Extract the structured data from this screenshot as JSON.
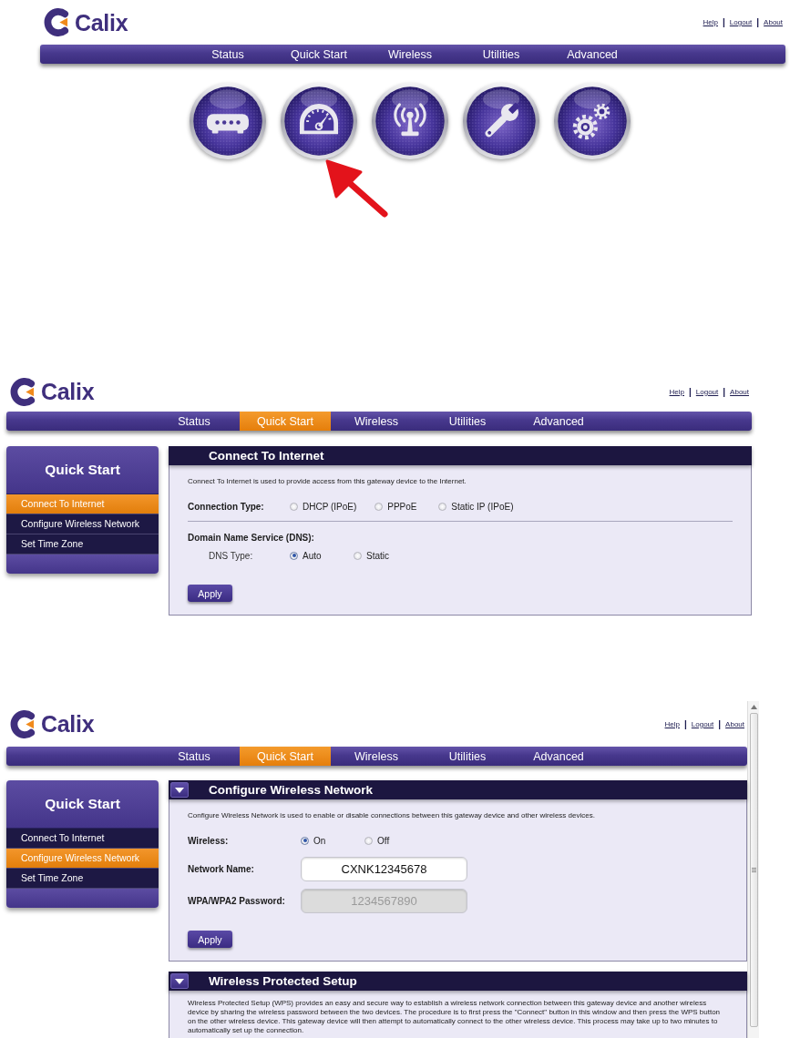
{
  "frames": [
    {
      "header": {
        "logo": "Calix",
        "links": [
          {
            "label": "Help",
            "separator": "|"
          },
          {
            "label": "Logout",
            "separator": "|"
          },
          {
            "label": "About"
          }
        ]
      },
      "nav": {
        "tabs": [
          {
            "label": "Status",
            "selected": false
          },
          {
            "label": "Quick Start",
            "selected": false
          },
          {
            "label": "Wireless",
            "selected": false
          },
          {
            "label": "Utilities",
            "selected": false
          },
          {
            "label": "Advanced",
            "selected": false
          }
        ]
      },
      "icon_buttons": [
        {
          "kind": "router",
          "annotated": false
        },
        {
          "kind": "gauge",
          "annotated": true
        },
        {
          "kind": "antenna",
          "annotated": false
        },
        {
          "kind": "wrench",
          "annotated": false
        },
        {
          "kind": "gears",
          "annotated": false
        }
      ]
    },
    {
      "header": {
        "logo": "Calix",
        "links": [
          {
            "label": "Help",
            "separator": "|"
          },
          {
            "label": "Logout",
            "separator": "|"
          },
          {
            "label": "About"
          }
        ]
      },
      "nav": {
        "tabs": [
          {
            "label": "Status",
            "selected": false
          },
          {
            "label": "Quick Start",
            "selected": true
          },
          {
            "label": "Wireless",
            "selected": false
          },
          {
            "label": "Utilities",
            "selected": false
          },
          {
            "label": "Advanced",
            "selected": false
          }
        ]
      },
      "sidebar": {
        "title": "Quick Start",
        "items": [
          {
            "label": "Connect To Internet",
            "selected": true
          },
          {
            "label": "Configure Wireless Network",
            "selected": false
          },
          {
            "label": "Set Time Zone",
            "selected": false
          }
        ]
      },
      "panels": [
        {
          "title": "Connect To Internet",
          "description": "Connect To Internet is used to provide access from this gateway device to the Internet.",
          "rows": [
            {
              "kind": "radio",
              "label": "Connection Type:",
              "options": [
                {
                  "label": "DHCP (IPoE)",
                  "selected": false
                },
                {
                  "label": "PPPoE",
                  "selected": false
                },
                {
                  "label": "Static IP (IPoE)",
                  "selected": false
                }
              ]
            },
            {
              "kind": "divider"
            },
            {
              "kind": "heading",
              "text": "Domain Name Service (DNS):"
            },
            {
              "kind": "subradio",
              "label": "DNS Type:",
              "options": [
                {
                  "label": "Auto",
                  "selected": true
                },
                {
                  "label": "Static",
                  "selected": false
                }
              ]
            }
          ],
          "button": "Apply"
        }
      ]
    },
    {
      "header": {
        "logo": "Calix",
        "links": [
          {
            "label": "Help",
            "separator": "|"
          },
          {
            "label": "Logout",
            "separator": "|"
          },
          {
            "label": "About"
          }
        ]
      },
      "nav": {
        "tabs": [
          {
            "label": "Status",
            "selected": false
          },
          {
            "label": "Quick Start",
            "selected": true
          },
          {
            "label": "Wireless",
            "selected": false
          },
          {
            "label": "Utilities",
            "selected": false
          },
          {
            "label": "Advanced",
            "selected": false
          }
        ]
      },
      "sidebar": {
        "title": "Quick Start",
        "items": [
          {
            "label": "Connect To Internet",
            "selected": false
          },
          {
            "label": "Configure Wireless Network",
            "selected": true
          },
          {
            "label": "Set Time Zone",
            "selected": false
          }
        ]
      },
      "panels": [
        {
          "toggle": {
            "expanded": true
          },
          "title": "Configure Wireless Network",
          "description": "Configure Wireless Network is used to enable or disable connections between this gateway device and other wireless devices.",
          "rows": [
            {
              "kind": "radio",
              "label": "Wireless:",
              "options": [
                {
                  "label": "On",
                  "selected": true
                },
                {
                  "label": "Off",
                  "selected": false
                }
              ]
            },
            {
              "kind": "field",
              "label": "Network Name:",
              "value": "CXNK12345678",
              "disabled": false
            },
            {
              "kind": "field",
              "label": "WPA/WPA2 Password:",
              "value": "1234567890",
              "disabled": true
            }
          ],
          "button": "Apply"
        },
        {
          "toggle": {
            "expanded": true
          },
          "title": "Wireless Protected Setup",
          "description": "Wireless Protected Setup (WPS) provides an easy and secure way to establish a wireless network connection between this gateway device and another wireless device by sharing the wireless password between the two devices. The procedure is to first press the \"Connect\" button in this window and then press the WPS button on the other wireless device. This gateway device will then attempt to automatically connect to the other wireless device. This process may take up to two minutes to automatically set up the connection."
        }
      ],
      "scrollbar": true
    }
  ]
}
